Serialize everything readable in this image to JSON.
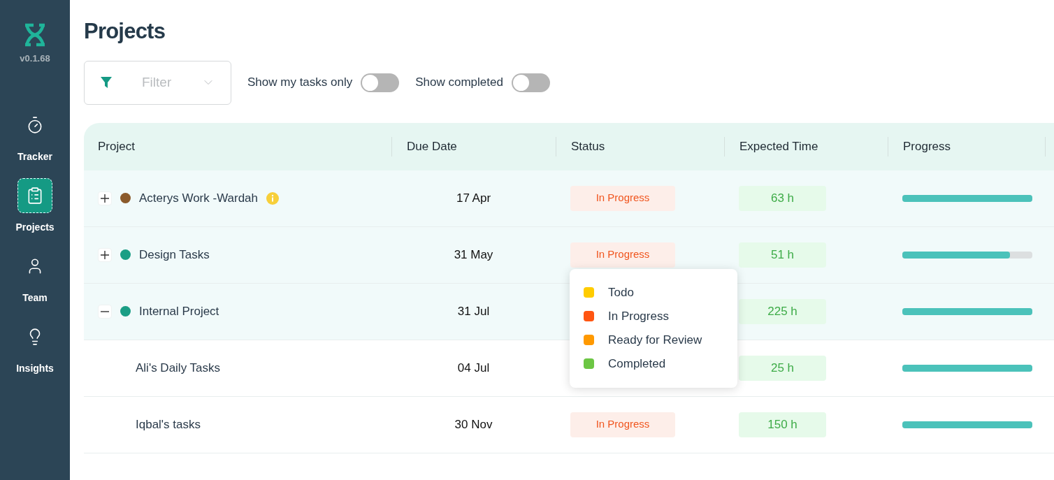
{
  "sidebar": {
    "version": "v0.1.68",
    "items": [
      {
        "label": "Tracker",
        "selected": false
      },
      {
        "label": "Projects",
        "selected": true
      },
      {
        "label": "Team",
        "selected": false
      },
      {
        "label": "Insights",
        "selected": false
      }
    ]
  },
  "page": {
    "title": "Projects"
  },
  "toolbar": {
    "filter": {
      "placeholder": "Filter"
    },
    "toggles": [
      {
        "label": "Show my tasks only",
        "on": false
      },
      {
        "label": "Show completed",
        "on": false
      }
    ]
  },
  "table": {
    "columns": [
      "Project",
      "Due Date",
      "Status",
      "Expected Time",
      "Progress"
    ],
    "rows": [
      {
        "name": "Acterys Work -Wardah",
        "color": "#8b5a2b",
        "info": true,
        "expanded": false,
        "due": "17 Apr",
        "status": "In Progress",
        "time": "63 h",
        "level": 1.0
      },
      {
        "name": "Design Tasks",
        "color": "#1a9e85",
        "expanded": false,
        "due": "31 May",
        "status": "In Progress",
        "time": "51 h",
        "level": 0.83
      },
      {
        "name": "Internal Project",
        "color": "#1a9e85",
        "expanded": true,
        "due": "31 Jul",
        "time": "225 h",
        "level": 1.0,
        "children": [
          {
            "name": "Ali's Daily Tasks",
            "due": "04 Jul",
            "time": "25 h",
            "level": 1.0
          },
          {
            "name": "Iqbal's tasks",
            "due": "30 Nov",
            "status": "In Progress",
            "time": "150 h",
            "level": 1.0
          }
        ]
      }
    ]
  },
  "status_menu": {
    "items": [
      {
        "label": "Todo",
        "color": "#ffcc00"
      },
      {
        "label": "In Progress",
        "color": "#ff5511"
      },
      {
        "label": "Ready for Review",
        "color": "#ff9900"
      },
      {
        "label": "Completed",
        "color": "#6cc644"
      }
    ]
  }
}
